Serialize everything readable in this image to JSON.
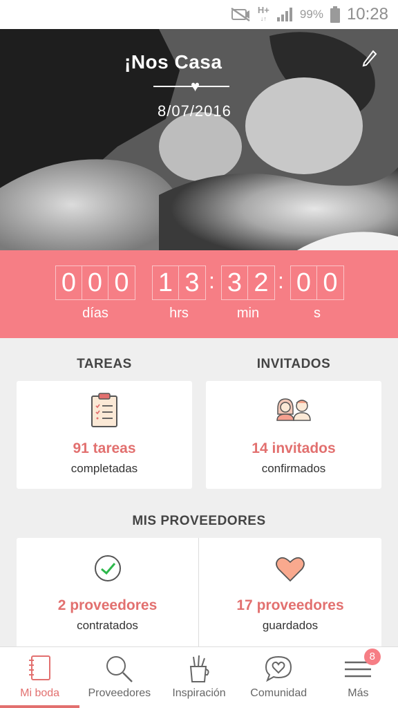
{
  "status_bar": {
    "network": "H+",
    "network_sub": "↓↑",
    "battery_percent": "99%",
    "time": "10:28"
  },
  "hero": {
    "title": "¡Nos Casa",
    "date": "8/07/2016"
  },
  "countdown": {
    "days_digits": [
      "0",
      "0",
      "0"
    ],
    "hours_digits": [
      "1",
      "3"
    ],
    "minutes_digits": [
      "3",
      "2"
    ],
    "seconds_digits": [
      "0",
      "0"
    ],
    "labels": {
      "days": "días",
      "hours": "hrs",
      "minutes": "min",
      "seconds": "s"
    }
  },
  "tasks": {
    "section_title": "TAREAS",
    "value": "91 tareas",
    "sub": "completadas"
  },
  "guests": {
    "section_title": "INVITADOS",
    "value": "14 invitados",
    "sub": "confirmados"
  },
  "vendors": {
    "section_title": "MIS PROVEEDORES",
    "hired_value": "2 proveedores",
    "hired_sub": "contratados",
    "saved_value": "17 proveedores",
    "saved_sub": "guardados"
  },
  "nav": {
    "items": [
      {
        "label": "Mi boda",
        "icon": "notebook-icon"
      },
      {
        "label": "Proveedores",
        "icon": "search-icon"
      },
      {
        "label": "Inspiración",
        "icon": "paint-brushes-icon"
      },
      {
        "label": "Comunidad",
        "icon": "chat-heart-icon"
      },
      {
        "label": "Más",
        "icon": "menu-icon"
      }
    ],
    "badge_count": "8"
  },
  "colors": {
    "accent": "#f67e85",
    "accent_text": "#e2706f"
  }
}
